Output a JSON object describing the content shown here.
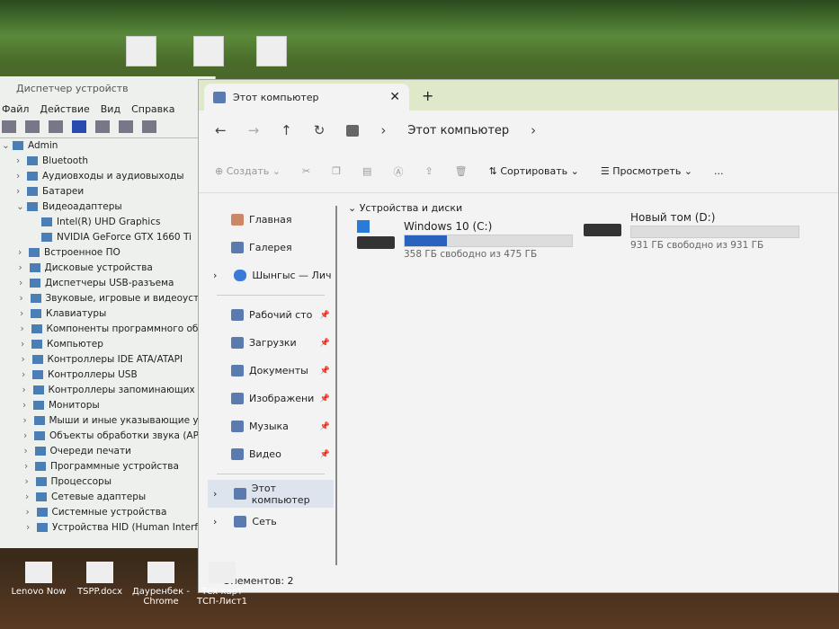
{
  "desktop_bottom": [
    "Lenovo Now",
    "TSPP.docx",
    "Дауренбек - Chrome",
    "Тех карт ТСП-Лист1"
  ],
  "device_manager": {
    "title": "Диспетчер устройств",
    "menu": [
      "Файл",
      "Действие",
      "Вид",
      "Справка"
    ],
    "root": "Admin",
    "items": [
      "Bluetooth",
      "Аудиовходы и аудиовыходы",
      "Батареи",
      "Видеоадаптеры"
    ],
    "video": [
      "Intel(R) UHD Graphics",
      "NVIDIA GeForce GTX 1660 Ti"
    ],
    "items2": [
      "Встроенное ПО",
      "Дисковые устройства",
      "Диспетчеры USB-разъема",
      "Звуковые, игровые и видеоустрой",
      "Клавиатуры",
      "Компоненты программного обесп",
      "Компьютер",
      "Контроллеры IDE ATA/ATAPI",
      "Контроллеры USB",
      "Контроллеры запоминающих устр",
      "Мониторы",
      "Мыши и иные указывающие устро",
      "Объекты обработки звука (APO)",
      "Очереди печати",
      "Программные устройства",
      "Процессоры",
      "Сетевые адаптеры",
      "Системные устройства",
      "Устройства HID (Human Interface D"
    ]
  },
  "explorer": {
    "tab": "Этот компьютер",
    "address": "Этот компьютер",
    "cmd": {
      "create": "Создать",
      "sort": "Сортировать",
      "view": "Просмотреть",
      "more": "..."
    },
    "sidebar": [
      {
        "label": "Главная"
      },
      {
        "label": "Галерея"
      },
      {
        "label": "Шынгыс — Лич"
      }
    ],
    "pinned": [
      "Рабочий сто",
      "Загрузки",
      "Документы",
      "Изображени",
      "Музыка",
      "Видео"
    ],
    "bottom": [
      "Этот компьютер",
      "Сеть"
    ],
    "group": "Устройства и диски",
    "drives": [
      {
        "name": "Windows 10 (C:)",
        "free": "358 ГБ свободно из 475 ГБ",
        "used_pct": 25
      },
      {
        "name": "Новый том (D:)",
        "free": "931 ГБ свободно из 931 ГБ",
        "used_pct": 0
      }
    ],
    "status": "Элементов: 2"
  },
  "colors": {
    "accent": "#2a62c0"
  }
}
